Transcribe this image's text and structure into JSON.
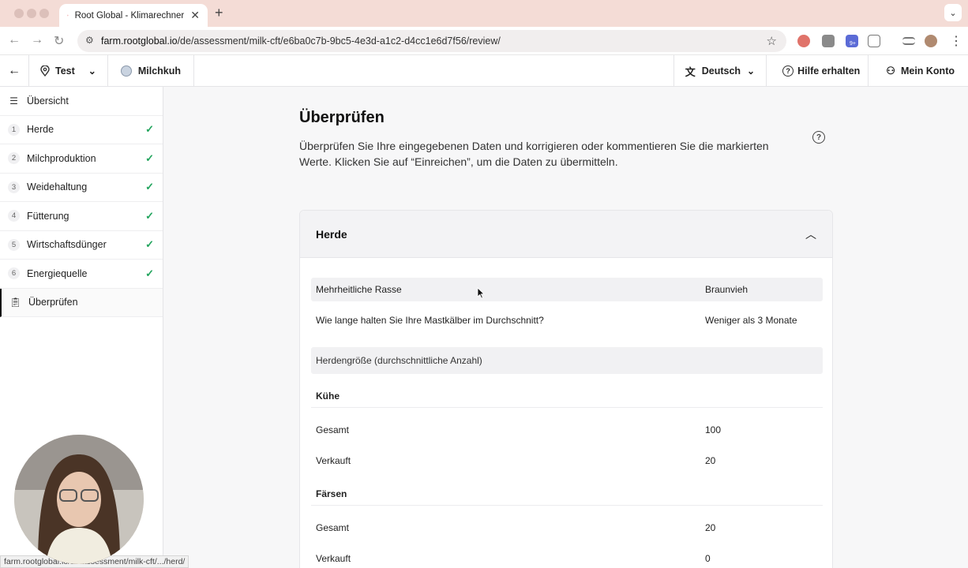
{
  "browser": {
    "tab_title": "Root Global - Klimarechner",
    "url_host": "farm.rootglobal.io",
    "url_path": "/de/assessment/milk-cft/e6ba0c7b-9bc5-4e3d-a1c2-d4cc1e6d7f56/review/",
    "extension_badge": "9+",
    "status_url": "farm.rootglobal.io/de/assessment/milk-cft/.../herd/"
  },
  "header": {
    "farm_name": "Test",
    "animal": "Milchkuh",
    "language": "Deutsch",
    "help": "Hilfe erhalten",
    "account": "Mein Konto"
  },
  "sidebar": {
    "overview": "Übersicht",
    "items": [
      {
        "num": "1",
        "label": "Herde"
      },
      {
        "num": "2",
        "label": "Milchproduktion"
      },
      {
        "num": "3",
        "label": "Weidehaltung"
      },
      {
        "num": "4",
        "label": "Fütterung"
      },
      {
        "num": "5",
        "label": "Wirtschaftsdünger"
      },
      {
        "num": "6",
        "label": "Energiequelle"
      }
    ],
    "review": "Überprüfen"
  },
  "main": {
    "title": "Überprüfen",
    "description": "Überprüfen Sie Ihre eingegebenen Daten und korrigieren oder kommentieren Sie die markierten Werte. Klicken Sie auf “Einreichen”, um die Daten zu übermitteln.",
    "section": {
      "title": "Herde",
      "rows": [
        {
          "label": "Mehrheitliche Rasse",
          "value": "Braunvieh"
        },
        {
          "label": "Wie lange halten Sie Ihre Mastkälber im Durchschnitt?",
          "value": "Weniger als 3 Monate"
        }
      ],
      "group_label": "Herdengröße (durchschnittliche Anzahl)",
      "kuehe": {
        "heading": "Kühe",
        "gesamt_label": "Gesamt",
        "gesamt": "100",
        "verkauft_label": "Verkauft",
        "verkauft": "20"
      },
      "faersen": {
        "heading": "Färsen",
        "gesamt_label": "Gesamt",
        "gesamt": "20",
        "verkauft_label": "Verkauft",
        "verkauft": "0"
      }
    }
  }
}
